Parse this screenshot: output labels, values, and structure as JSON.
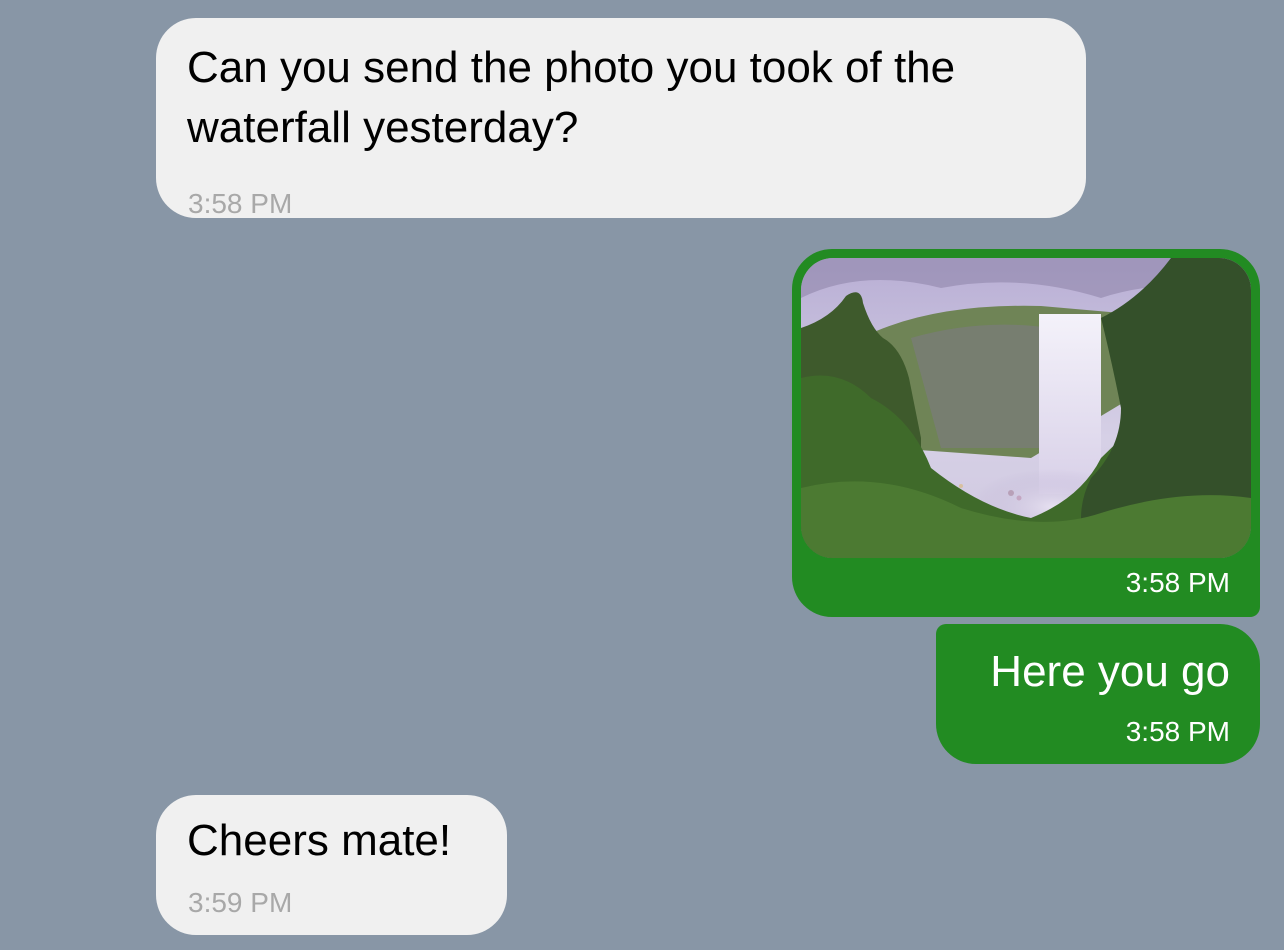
{
  "chat": {
    "messages": [
      {
        "direction": "incoming",
        "text": "Can you send the photo you took of the waterfall yesterday?",
        "time": "3:58 PM"
      },
      {
        "direction": "outgoing",
        "type": "photo",
        "photo_subject": "waterfall",
        "time": "3:58 PM"
      },
      {
        "direction": "outgoing",
        "text": "Here you go",
        "time": "3:58 PM"
      },
      {
        "direction": "incoming",
        "text": "Cheers mate!",
        "time": "3:59 PM"
      }
    ]
  },
  "colors": {
    "background": "#8896a6",
    "incoming_bubble": "#f0f0f0",
    "outgoing_bubble": "#228b22",
    "incoming_time": "#a8a8a8"
  }
}
